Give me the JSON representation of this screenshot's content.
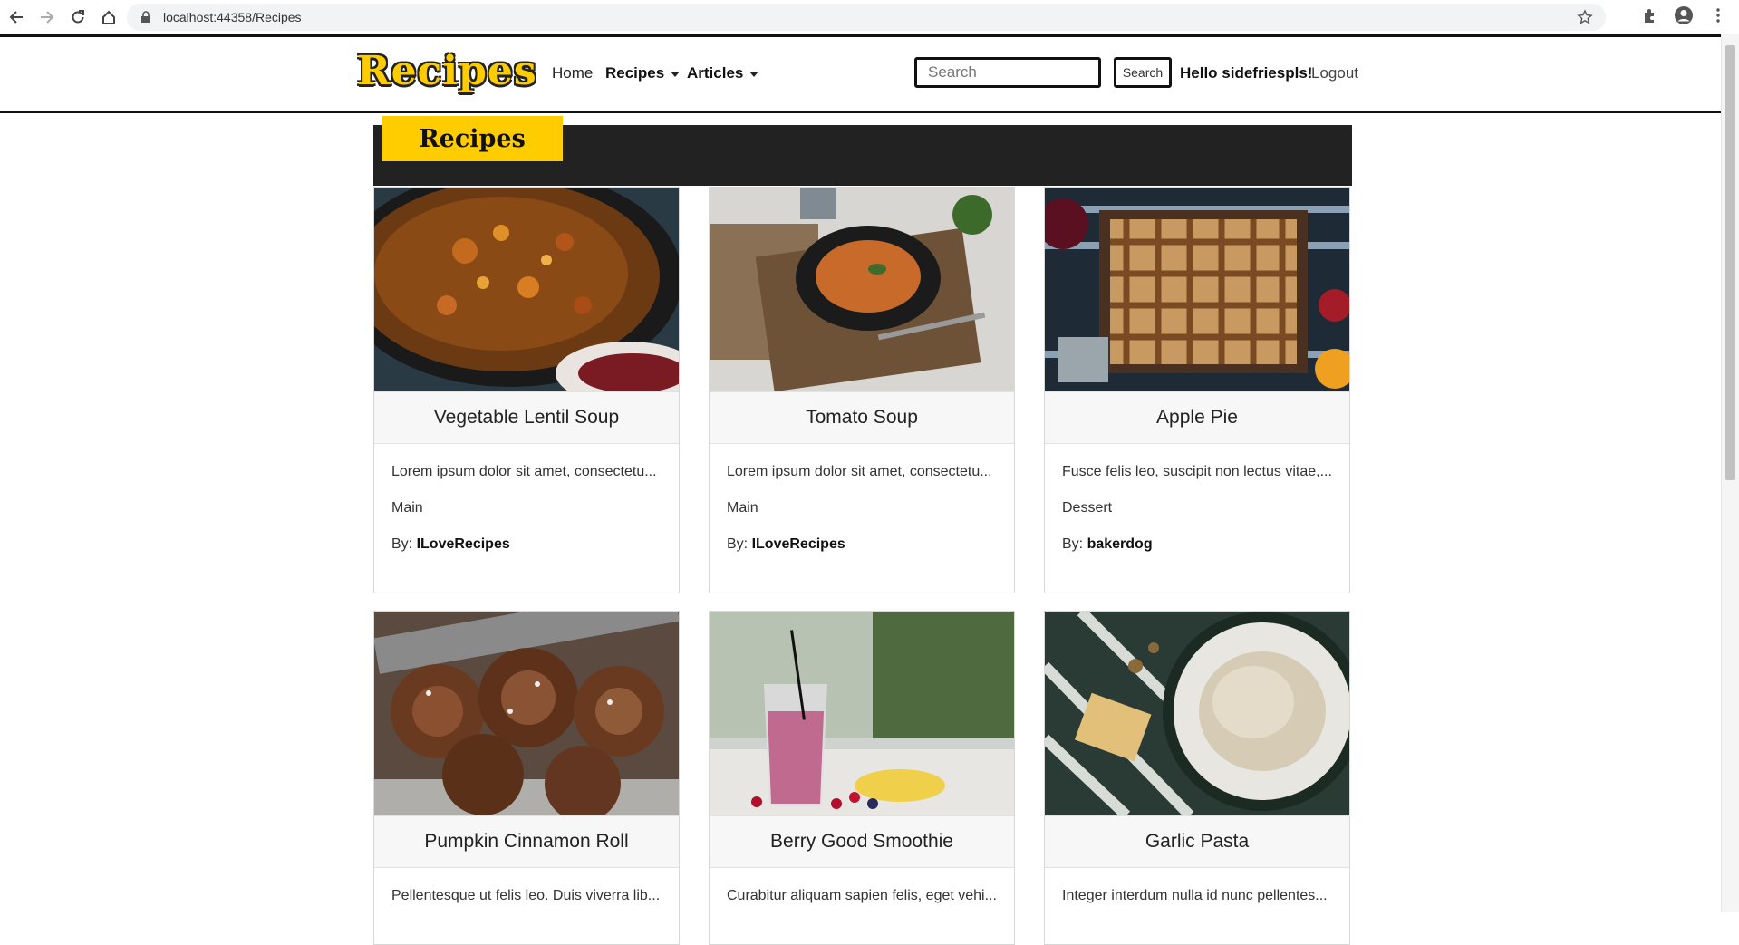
{
  "browser": {
    "url": "localhost:44358/Recipes"
  },
  "site": {
    "logo_text": "Recipes",
    "nav": {
      "home": "Home",
      "recipes": "Recipes",
      "articles": "Articles"
    },
    "search": {
      "placeholder": "Search",
      "button_label": "Search"
    },
    "greeting": "Hello sidefriespls!",
    "logout": "Logout"
  },
  "banner": {
    "title": "Recipes"
  },
  "cards": [
    {
      "title": "Vegetable Lentil Soup",
      "desc": "Lorem ipsum dolor sit amet, consectetu...",
      "category": "Main",
      "by_label": "By:",
      "author": "ILoveRecipes"
    },
    {
      "title": "Tomato Soup",
      "desc": "Lorem ipsum dolor sit amet, consectetu...",
      "category": "Main",
      "by_label": "By:",
      "author": "ILoveRecipes"
    },
    {
      "title": "Apple Pie",
      "desc": "Fusce felis leo, suscipit non lectus vitae,...",
      "category": "Dessert",
      "by_label": "By:",
      "author": "bakerdog"
    },
    {
      "title": "Pumpkin Cinnamon Roll",
      "desc": "Pellentesque ut felis leo. Duis viverra lib..."
    },
    {
      "title": "Berry Good Smoothie",
      "desc": "Curabitur aliquam sapien felis, eget vehi..."
    },
    {
      "title": "Garlic Pasta",
      "desc": "Integer interdum nulla id nunc pellentes..."
    }
  ],
  "colors": {
    "accent_yellow": "#ffcc00",
    "banner_dark": "#222222"
  }
}
